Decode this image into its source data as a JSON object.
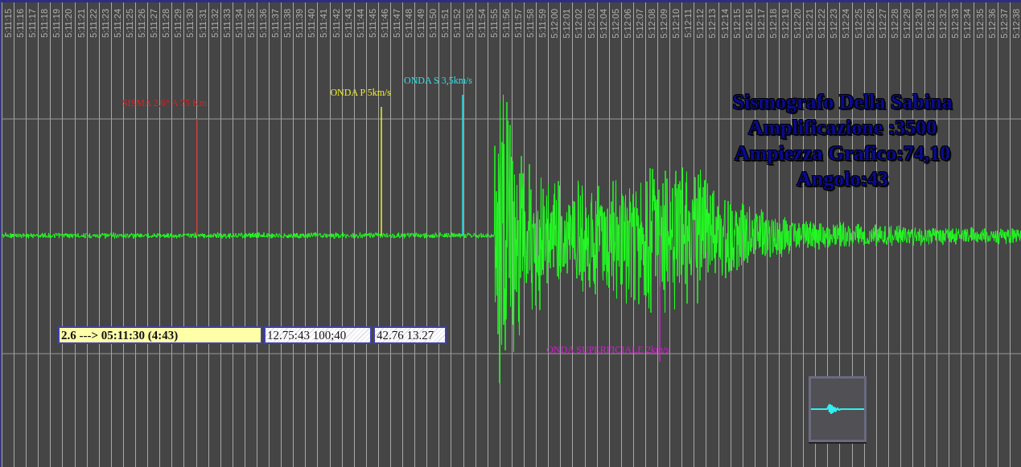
{
  "time_labels": [
    "5:11:15",
    "5:11:16",
    "5:11:17",
    "5:11:18",
    "5:11:19",
    "5:11:20",
    "5:11:21",
    "5:11:22",
    "5:11:23",
    "5:11:24",
    "5:11:25",
    "5:11:26",
    "5:11:27",
    "5:11:28",
    "5:11:29",
    "5:11:30",
    "5:11:31",
    "5:11:32",
    "5:11:33",
    "5:11:34",
    "5:11:35",
    "5:11:36",
    "5:11:37",
    "5:11:38",
    "5:11:39",
    "5:11:40",
    "5:11:41",
    "5:11:42",
    "5:11:43",
    "5:11:44",
    "5:11:45",
    "5:11:46",
    "5:11:47",
    "5:11:48",
    "5:11:49",
    "5:11:50",
    "5:11:51",
    "5:11:52",
    "5:11:53",
    "5:11:54",
    "5:11:55",
    "5:11:56",
    "5:11:57",
    "5:11:58",
    "5:11:59",
    "5:12:00",
    "5:12:01",
    "5:12:02",
    "5:12:03",
    "5:12:04",
    "5:12:05",
    "5:12:06",
    "5:12:07",
    "5:12:08",
    "5:12:09",
    "5:12:10",
    "5:12:11",
    "5:12:12",
    "5:12:13",
    "5:12:14",
    "5:12:15",
    "5:12:16",
    "5:12:17",
    "5:12:18",
    "5:12:19",
    "5:12:20",
    "5:12:21",
    "5:12:22",
    "5:12:23",
    "5:12:24",
    "5:12:25",
    "5:12:26",
    "5:12:27",
    "5:12:28",
    "5:12:29",
    "5:12:30",
    "5:12:31",
    "5:12:32",
    "5:12:33",
    "5:12:34",
    "5:12:35",
    "5:12:36",
    "5:12:37",
    "5:12:38"
  ],
  "markers": [
    {
      "label": "SISMA 2,6° A 75 Km",
      "color": "#e02020"
    },
    {
      "label": "ONDA P 5km/s",
      "color": "#f0f020"
    },
    {
      "label": "ONDA S 3,5km/s",
      "color": "#30e0e8"
    },
    {
      "label": "ONDA SUPERFICIALE 2km/s",
      "color": "#d020d0"
    }
  ],
  "title_lines": [
    "Sismografo Della Sabina",
    "Amplificazione :3500",
    "Ampiezza Grafico:74,10",
    "Angolo:43"
  ],
  "readout": [
    {
      "text": "2.6 ---> 05:11:30 (4:43)",
      "kind": "highlight"
    },
    {
      "text": "12.75:43 100;40",
      "kind": "hatched"
    },
    {
      "text": "42.76 13.27",
      "kind": "hatched"
    }
  ]
}
